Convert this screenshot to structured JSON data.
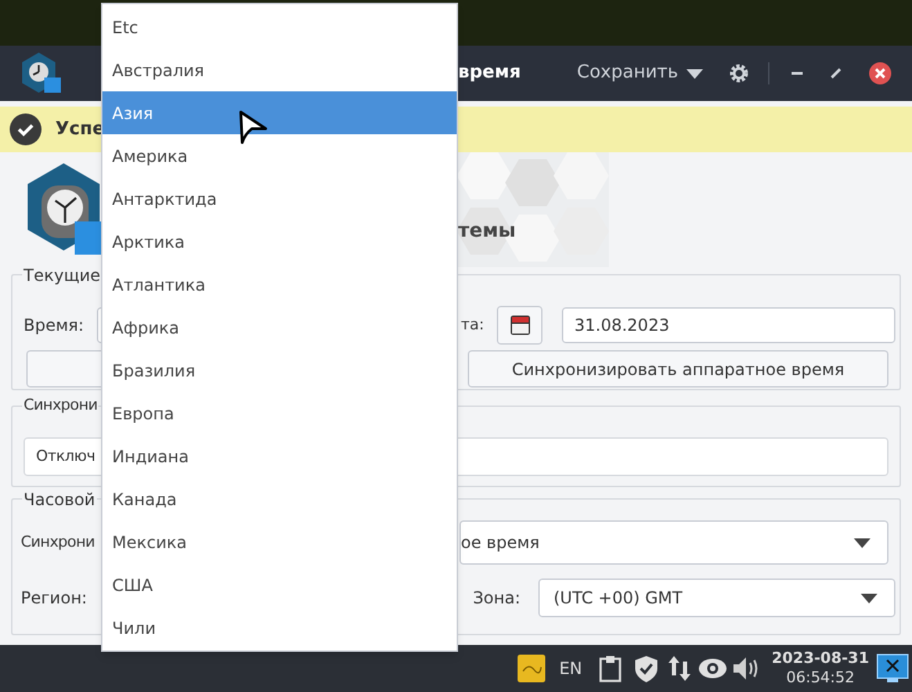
{
  "window": {
    "title": "время",
    "save_menu": "Сохранить"
  },
  "notification": {
    "text": "Успе"
  },
  "header": {
    "title": "темы"
  },
  "current_group": {
    "legend": "Текущие",
    "time_label": "Время:",
    "date_label": "та:",
    "date_value": "31.08.2023",
    "sync_button": "Синхронизировать аппаратное время"
  },
  "sync_group": {
    "legend": "Синхрони",
    "mode_value": "Отключ"
  },
  "timezone_group": {
    "legend": "Часовой",
    "sync_label": "Синхрони",
    "sync_value": "ое время",
    "region_label": "Регион:",
    "zone_label": "Зона:",
    "zone_value": "(UTC +00) GMT"
  },
  "region_dropdown": [
    {
      "label": "Etc",
      "selected": false
    },
    {
      "label": "Австралия",
      "selected": false
    },
    {
      "label": "Азия",
      "selected": true
    },
    {
      "label": "Америка",
      "selected": false
    },
    {
      "label": "Антарктида",
      "selected": false
    },
    {
      "label": "Арктика",
      "selected": false
    },
    {
      "label": "Атлантика",
      "selected": false
    },
    {
      "label": "Африка",
      "selected": false
    },
    {
      "label": "Бразилия",
      "selected": false
    },
    {
      "label": "Европа",
      "selected": false
    },
    {
      "label": "Индиана",
      "selected": false
    },
    {
      "label": "Канада",
      "selected": false
    },
    {
      "label": "Мексика",
      "selected": false
    },
    {
      "label": "США",
      "selected": false
    },
    {
      "label": "Чили",
      "selected": false
    }
  ],
  "taskbar": {
    "language": "EN",
    "date": "2023-08-31",
    "time": "06:54:52"
  }
}
